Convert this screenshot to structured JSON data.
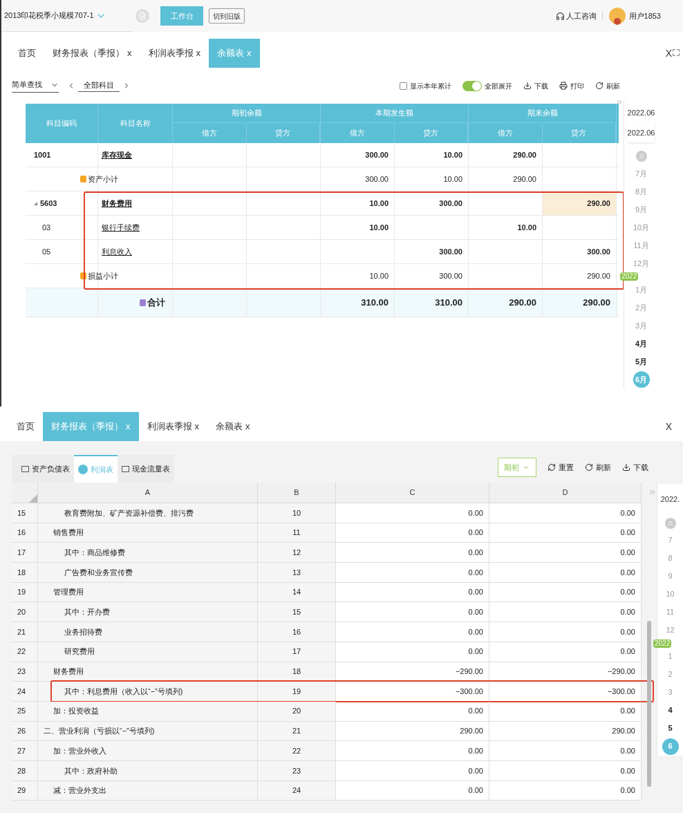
{
  "top": {
    "header": {
      "company": "2013印花税季小规模707-1",
      "workbench_button": "工作台",
      "switch_button": "切到旧版",
      "consult": "人工咨询",
      "user": "用户1853"
    },
    "tabs": [
      {
        "label": "首页",
        "selected": false
      },
      {
        "label": "财务报表（季报）",
        "close": "x",
        "selected": false
      },
      {
        "label": "利润表季报",
        "close": "x",
        "selected": false
      },
      {
        "label": "余额表",
        "close": "x",
        "selected": true
      }
    ],
    "window_close": "X",
    "toolbar": {
      "search_mode": "简单查找",
      "scope": "全部科目",
      "year_total": {
        "label": "显示本年累计",
        "checked": false
      },
      "expand_all": {
        "label": "全部展开",
        "on": true
      },
      "actions": [
        {
          "kind": "download",
          "label": "下载"
        },
        {
          "kind": "print",
          "label": "打印"
        },
        {
          "kind": "refresh",
          "label": "刷新"
        }
      ]
    },
    "table": {
      "columns": [
        "科目编码",
        "科目名称"
      ],
      "groups": [
        {
          "label": "期初余额",
          "sub": [
            "借方",
            "贷方"
          ]
        },
        {
          "label": "本期发生额",
          "sub": [
            "借方",
            "贷方"
          ]
        },
        {
          "label": "期末余额",
          "sub": [
            "借方",
            "贷方"
          ]
        }
      ],
      "rows": [
        {
          "kind": "account",
          "code": "1001",
          "name": "库存现金",
          "expanded": false,
          "boxed": false,
          "cells": [
            {
              "selected": false
            },
            {
              "selected": false
            },
            {
              "text": "300.00",
              "selected": false
            },
            {
              "text": "10.00",
              "selected": false
            },
            {
              "text": "290.00",
              "selected": false
            },
            {
              "selected": false
            }
          ]
        },
        {
          "kind": "subtotal",
          "name": "资产小计",
          "color": "#f5a623",
          "boxed": false,
          "cells": [
            {
              "selected": false
            },
            {
              "selected": false
            },
            {
              "text": "300.00",
              "selected": false
            },
            {
              "text": "10.00",
              "selected": false
            },
            {
              "text": "290.00",
              "selected": false
            },
            {
              "selected": false
            }
          ]
        },
        {
          "kind": "account",
          "code": "5603",
          "name": "财务费用",
          "expanded": true,
          "boxed": true,
          "cells": [
            {
              "selected": false
            },
            {
              "selected": false
            },
            {
              "text": "10.00",
              "selected": false
            },
            {
              "text": "300.00",
              "selected": false
            },
            {
              "selected": false
            },
            {
              "text": "290.00",
              "selected": true
            }
          ]
        },
        {
          "kind": "sub",
          "code": "03",
          "name": "银行手续费",
          "boxed": true,
          "cells": [
            {
              "selected": false
            },
            {
              "selected": false
            },
            {
              "text": "10.00",
              "selected": false
            },
            {
              "selected": false
            },
            {
              "text": "10.00",
              "selected": false
            },
            {
              "selected": false
            }
          ]
        },
        {
          "kind": "sub",
          "code": "05",
          "name": "利息收入",
          "boxed": true,
          "cells": [
            {
              "selected": false
            },
            {
              "selected": false
            },
            {
              "selected": false
            },
            {
              "text": "300.00",
              "selected": false
            },
            {
              "selected": false
            },
            {
              "text": "300.00",
              "selected": false
            }
          ]
        },
        {
          "kind": "subtotal",
          "name": "损益小计",
          "color": "#f5a623",
          "boxed": true,
          "cells": [
            {
              "selected": false
            },
            {
              "selected": false
            },
            {
              "text": "10.00",
              "selected": false
            },
            {
              "text": "300.00",
              "selected": false
            },
            {
              "selected": false
            },
            {
              "text": "290.00",
              "selected": false
            }
          ]
        },
        {
          "kind": "total",
          "name": "合计",
          "color": "#9b7fd4",
          "boxed": false,
          "cells": [
            {
              "selected": false
            },
            {
              "selected": false
            },
            {
              "text": "310.00",
              "selected": false
            },
            {
              "text": "310.00",
              "selected": false
            },
            {
              "text": "290.00",
              "selected": false
            },
            {
              "text": "290.00",
              "selected": false
            }
          ]
        }
      ]
    },
    "periods": {
      "from": "2022.06",
      "to": "2022.06",
      "months": [
        {
          "kind": "month",
          "label": "7月",
          "enabled": false,
          "selected": false
        },
        {
          "kind": "month",
          "label": "8月",
          "enabled": false,
          "selected": false
        },
        {
          "kind": "month",
          "label": "9月",
          "enabled": false,
          "selected": false
        },
        {
          "kind": "month",
          "label": "10月",
          "enabled": false,
          "selected": false
        },
        {
          "kind": "month",
          "label": "11月",
          "enabled": false,
          "selected": false
        },
        {
          "kind": "month",
          "label": "12月",
          "enabled": false,
          "selected": false
        },
        {
          "kind": "year",
          "label": "2022"
        },
        {
          "kind": "month",
          "label": "1月",
          "enabled": false,
          "selected": false
        },
        {
          "kind": "month",
          "label": "2月",
          "enabled": false,
          "selected": false
        },
        {
          "kind": "month",
          "label": "3月",
          "enabled": false,
          "selected": false
        },
        {
          "kind": "month",
          "label": "4月",
          "enabled": true,
          "selected": false
        },
        {
          "kind": "month",
          "label": "5月",
          "enabled": true,
          "selected": false
        },
        {
          "kind": "month",
          "label": "6月",
          "enabled": true,
          "selected": true
        }
      ]
    }
  },
  "bottom": {
    "tabs": [
      {
        "label": "首页",
        "selected": false
      },
      {
        "label": "财务报表（季报）",
        "close": "x",
        "selected": true
      },
      {
        "label": "利润表季报",
        "close": "x",
        "selected": false
      },
      {
        "label": "余额表",
        "close": "x",
        "selected": false
      }
    ],
    "window_close": "X",
    "report_tabs": [
      {
        "label": "资产负债表",
        "selected": false
      },
      {
        "label": "利润表",
        "selected": true
      },
      {
        "label": "现金流量表",
        "selected": false
      }
    ],
    "period_select": "期初",
    "actions": [
      {
        "kind": "reset",
        "label": "重置"
      },
      {
        "kind": "refresh",
        "label": "刷新"
      },
      {
        "kind": "download",
        "label": "下载"
      }
    ],
    "sheet": {
      "columns": [
        "A",
        "B",
        "C",
        "D"
      ],
      "rows": [
        {
          "num": "15",
          "kind": "sub",
          "item": "教育费附加、矿产资源补偿费、排污费",
          "line": "10",
          "c": "0.00",
          "d": "0.00",
          "boxed": false
        },
        {
          "num": "16",
          "kind": "item",
          "item": "销售费用",
          "line": "11",
          "c": "0.00",
          "d": "0.00",
          "boxed": false
        },
        {
          "num": "17",
          "kind": "sub",
          "item": "其中：商品维修费",
          "line": "12",
          "c": "0.00",
          "d": "0.00",
          "boxed": false
        },
        {
          "num": "18",
          "kind": "sub",
          "item": "广告费和业务宣传费",
          "line": "13",
          "c": "0.00",
          "d": "0.00",
          "boxed": false
        },
        {
          "num": "19",
          "kind": "item",
          "item": "管理费用",
          "line": "14",
          "c": "0.00",
          "d": "0.00",
          "boxed": false
        },
        {
          "num": "20",
          "kind": "sub",
          "item": "其中：开办费",
          "line": "15",
          "c": "0.00",
          "d": "0.00",
          "boxed": false
        },
        {
          "num": "21",
          "kind": "sub",
          "item": "业务招待费",
          "line": "16",
          "c": "0.00",
          "d": "0.00",
          "boxed": false
        },
        {
          "num": "22",
          "kind": "sub",
          "item": "研究费用",
          "line": "17",
          "c": "0.00",
          "d": "0.00",
          "boxed": false
        },
        {
          "num": "23",
          "kind": "item",
          "item": "财务费用",
          "line": "18",
          "c": "−290.00",
          "d": "−290.00",
          "boxed": false
        },
        {
          "num": "24",
          "kind": "sub",
          "item": "其中：利息费用（收入以“−”号填列)",
          "line": "19",
          "c": "−300.00",
          "d": "−300.00",
          "boxed": true
        },
        {
          "num": "25",
          "kind": "item",
          "item": "加：投资收益",
          "line": "20",
          "c": "0.00",
          "d": "0.00",
          "boxed": false
        },
        {
          "num": "26",
          "kind": "top",
          "item": "二、营业利润（亏损以“−”号填列)",
          "line": "21",
          "c": "290.00",
          "d": "290.00",
          "boxed": false
        },
        {
          "num": "27",
          "kind": "item",
          "item": "加：营业外收入",
          "line": "22",
          "c": "0.00",
          "d": "0.00",
          "boxed": false
        },
        {
          "num": "28",
          "kind": "sub",
          "item": "其中：政府补助",
          "line": "23",
          "c": "0.00",
          "d": "0.00",
          "boxed": false
        },
        {
          "num": "29",
          "kind": "item",
          "item": "减：营业外支出",
          "line": "24",
          "c": "0.00",
          "d": "0.00",
          "boxed": false
        }
      ]
    },
    "periods": {
      "from": "2022.",
      "months": [
        {
          "kind": "month",
          "label": "7",
          "enabled": false,
          "selected": false
        },
        {
          "kind": "month",
          "label": "8",
          "enabled": false,
          "selected": false
        },
        {
          "kind": "month",
          "label": "9",
          "enabled": false,
          "selected": false
        },
        {
          "kind": "month",
          "label": "10",
          "enabled": false,
          "selected": false
        },
        {
          "kind": "month",
          "label": "11",
          "enabled": false,
          "selected": false
        },
        {
          "kind": "month",
          "label": "12",
          "enabled": false,
          "selected": false
        },
        {
          "kind": "year",
          "label": "2022"
        },
        {
          "kind": "month",
          "label": "1",
          "enabled": false,
          "selected": false
        },
        {
          "kind": "month",
          "label": "2",
          "enabled": false,
          "selected": false
        },
        {
          "kind": "month",
          "label": "3",
          "enabled": false,
          "selected": false
        },
        {
          "kind": "month",
          "label": "4",
          "enabled": true,
          "selected": false
        },
        {
          "kind": "month",
          "label": "5",
          "enabled": true,
          "selected": false
        },
        {
          "kind": "month",
          "label": "6",
          "enabled": true,
          "selected": true
        }
      ]
    }
  }
}
